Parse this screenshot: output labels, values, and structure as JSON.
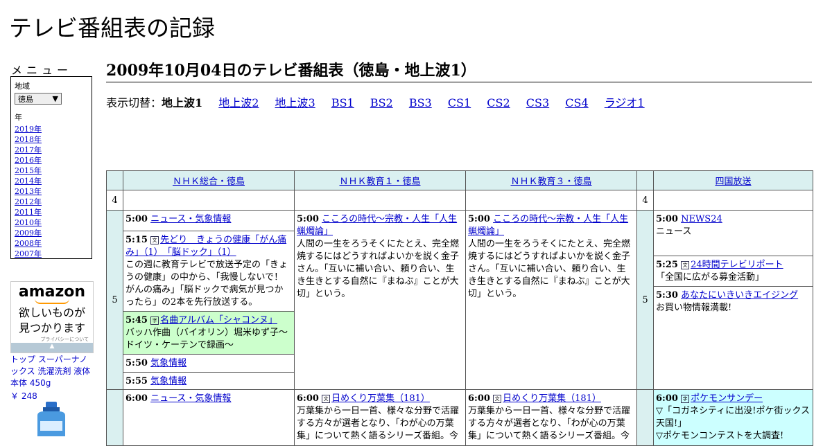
{
  "site_title": "テレビ番組表の記録",
  "menu": {
    "label": "メニュー",
    "region_caption": "地域",
    "region_value": "徳島",
    "year_caption": "年",
    "years": [
      "2019年",
      "2018年",
      "2017年",
      "2016年",
      "2015年",
      "2014年",
      "2013年",
      "2012年",
      "2011年",
      "2010年",
      "2009年",
      "2008年",
      "2007年"
    ]
  },
  "ad": {
    "brand": "amazon",
    "tagline_1": "欲しいものが",
    "tagline_2": "見つかります",
    "privacy": "プライバシーについて",
    "product_name": "トップ スーパーナノックス 洗濯洗剤 液体 本体 450g",
    "product_price": "￥ 248"
  },
  "page_heading": "2009年10月04日のテレビ番組表（徳島・地上波1）",
  "switcher": {
    "prefix": "表示切替：",
    "current": "地上波1",
    "links": [
      "地上波2",
      "地上波3",
      "BS1",
      "BS2",
      "BS3",
      "CS1",
      "CS2",
      "CS3",
      "CS4",
      "ラジオ1"
    ]
  },
  "channels": [
    "ＮＨＫ総合・徳島",
    "ＮＨＫ教育１・徳島",
    "ＮＨＫ教育３・徳島",
    "四国放送"
  ],
  "hours": [
    "4",
    "5"
  ],
  "col1": [
    {
      "time": "5:00",
      "title": "ニュース・気象情報",
      "icon": "",
      "desc": ""
    },
    {
      "time": "5:15",
      "title": "先どり　きょうの健康「がん痛み」（1）　「脳ドック」（1）",
      "icon": "文",
      "desc": "この週に教育テレビで放送予定の「きょうの健康」の中から、「我慢しないで！がんの痛み」「脳ドックで病気が見つかったら」の2本を先行放送する。"
    },
    {
      "time": "5:45",
      "title": "名曲アルバム「シャコンヌ」",
      "icon": "字",
      "desc": "バッハ作曲（バイオリン）堀米ゆず子～ドイツ・ケーテンで録画～"
    },
    {
      "time": "5:50",
      "title": "気象情報",
      "icon": "",
      "desc": ""
    },
    {
      "time": "5:55",
      "title": "気象情報",
      "icon": "",
      "desc": ""
    }
  ],
  "col2": [
    {
      "time": "5:00",
      "title": "こころの時代～宗教・人生「人生蝋燭論」",
      "desc": "人間の一生をろうそくにたとえ、完全燃焼するにはどうすればよいかを説く金子さん。「互いに補い合い、頼り合い、生き生きとする自然に『まねぶ』ことが大切」という。"
    }
  ],
  "col3": [
    {
      "time": "5:00",
      "title": "こころの時代～宗教・人生「人生蝋燭論」",
      "desc": "人間の一生をろうそくにたとえ、完全燃焼するにはどうすればよいかを説く金子さん。「互いに補い合い、頼り合い、生き生きとする自然に『まねぶ』ことが大切」という。"
    }
  ],
  "col4": [
    {
      "time": "5:00",
      "title": "NEWS24",
      "icon": "",
      "desc": "ニュース"
    },
    {
      "time": "5:25",
      "title": "24時間テレビリポート",
      "icon": "文",
      "desc": "「全国に広がる募金活動」"
    },
    {
      "time": "5:30",
      "title": "あなたにいきいきエイジング",
      "icon": "",
      "desc": "お買い物情報満載!"
    }
  ],
  "row6": {
    "c1": {
      "time": "6:00",
      "title": "ニュース・気象情報"
    },
    "c2": {
      "time": "6:00",
      "title": "日めくり万葉集（181）",
      "icon": "文",
      "desc": "万葉集から一日一首、様々な分野で活躍する方々が選者となり、「わが心の万葉集」について熱く語るシリーズ番組。今"
    },
    "c3": {
      "time": "6:00",
      "title": "日めくり万葉集（181）",
      "icon": "文",
      "desc": "万葉集から一日一首、様々な分野で活躍する方々が選者となり、「わが心の万葉集」について熱く語るシリーズ番組。今"
    },
    "c4": {
      "time": "6:00",
      "title": "ポケモンサンデー",
      "icon": "字",
      "desc1": "▽「コガネシティに出没!ポケ街ックス天国!」",
      "desc2": "▽ポケモンコンテストを大調査!"
    }
  }
}
